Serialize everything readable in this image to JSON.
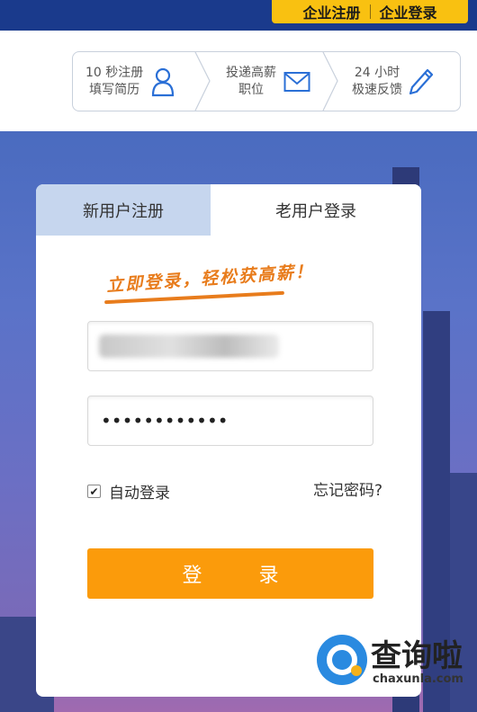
{
  "header": {
    "corp_register": "企业注册",
    "corp_login": "企业登录"
  },
  "steps": [
    {
      "line1": "10 秒注册",
      "line2": "填写简历",
      "icon": "person-icon"
    },
    {
      "line1": "投递高薪",
      "line2": "职位",
      "icon": "envelope-icon"
    },
    {
      "line1": "24 小时",
      "line2": "极速反馈",
      "icon": "pencil-icon"
    }
  ],
  "card": {
    "tab_new_user": "新用户注册",
    "tab_old_user": "老用户登录",
    "slogan": "立即登录，轻松获高薪！",
    "password_value": "••••••••••••",
    "auto_login_label": "自动登录",
    "auto_login_checked": true,
    "forgot_password": "忘记密码?",
    "login_button": "登 录"
  },
  "watermark": {
    "brand": "查询啦",
    "domain": "chaxunla.com"
  },
  "colors": {
    "header_blue": "#1a3a8c",
    "corp_yellow": "#f9c111",
    "login_orange": "#fb9b0b",
    "slogan_orange": "#e87c1c",
    "tab_inactive": "#c6d6ee"
  }
}
